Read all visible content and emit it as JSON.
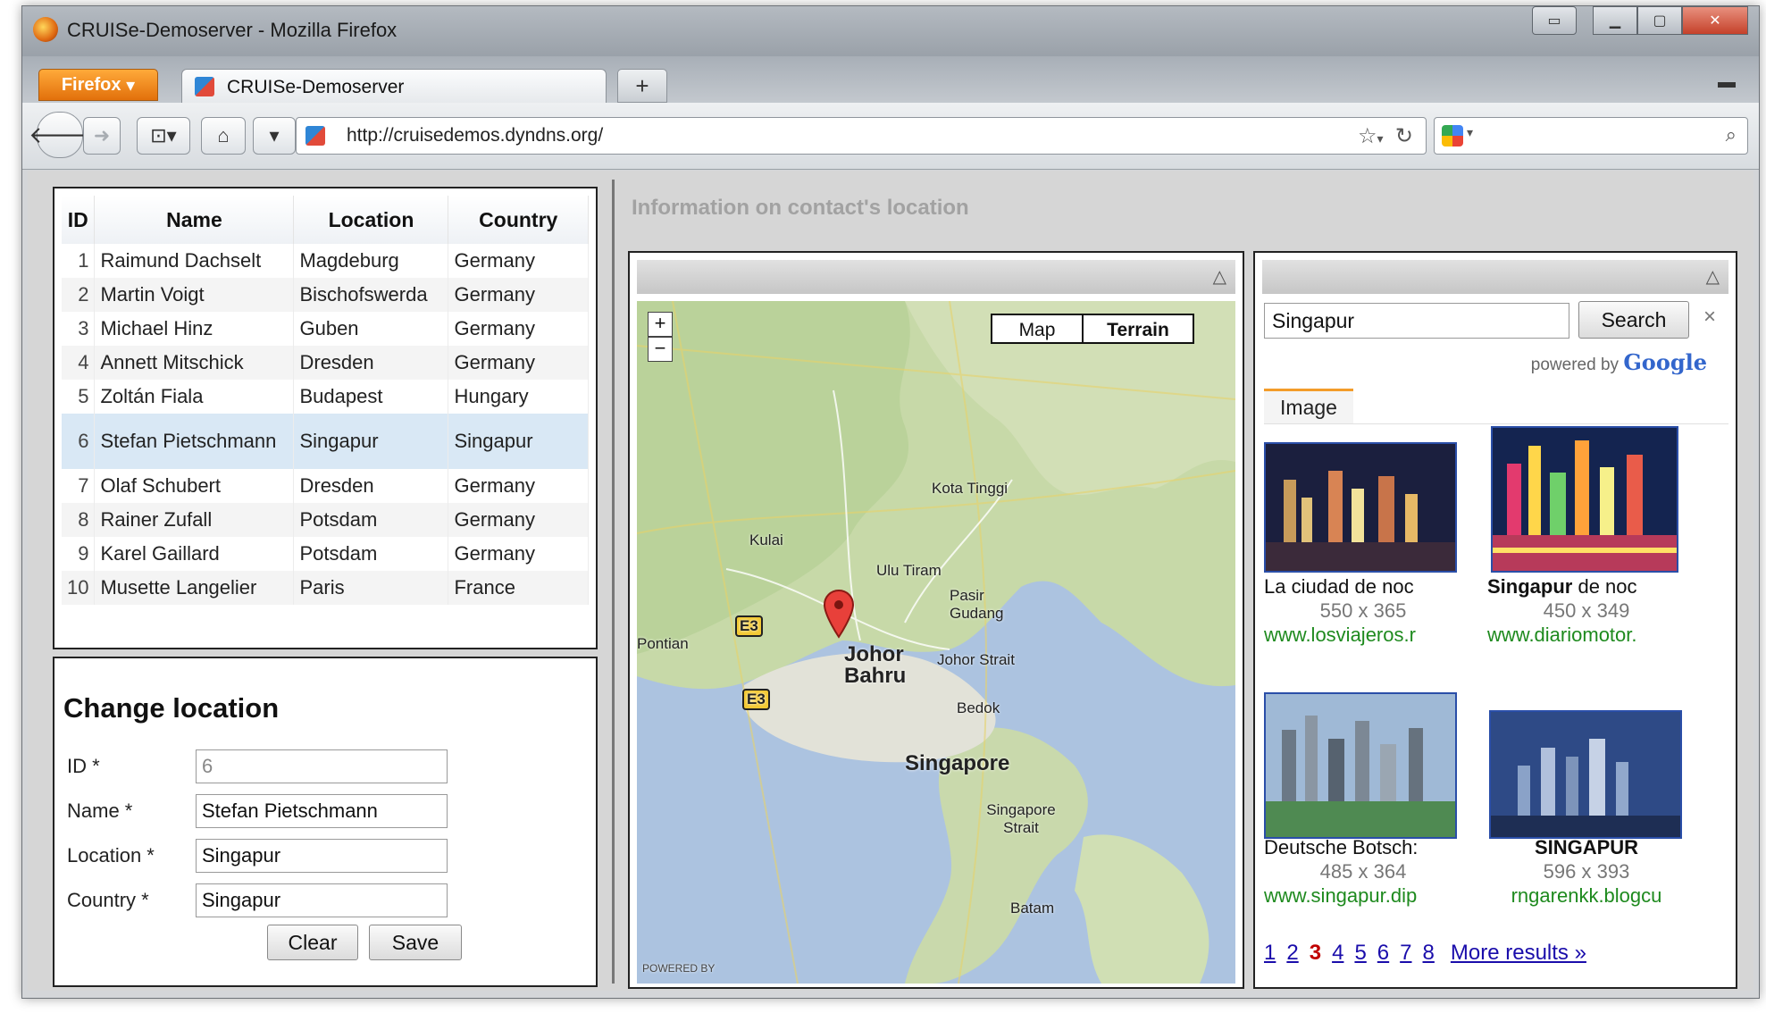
{
  "window": {
    "title": "CRUISe-Demoserver - Mozilla Firefox"
  },
  "browser": {
    "menu_label": "Firefox",
    "tab_title": "CRUISe-Demoserver",
    "new_tab": "+",
    "url": "http://cruisedemos.dyndns.org/"
  },
  "contacts": {
    "columns": [
      "ID",
      "Name",
      "Location",
      "Country"
    ],
    "rows": [
      {
        "id": "1",
        "name": "Raimund Dachselt",
        "location": "Magdeburg",
        "country": "Germany"
      },
      {
        "id": "2",
        "name": "Martin Voigt",
        "location": "Bischofswerda",
        "country": "Germany"
      },
      {
        "id": "3",
        "name": "Michael Hinz",
        "location": "Guben",
        "country": "Germany"
      },
      {
        "id": "4",
        "name": "Annett Mitschick",
        "location": "Dresden",
        "country": "Germany"
      },
      {
        "id": "5",
        "name": "Zoltán Fiala",
        "location": "Budapest",
        "country": "Hungary"
      },
      {
        "id": "6",
        "name": "Stefan Pietschmann",
        "location": "Singapur",
        "country": "Singapur"
      },
      {
        "id": "7",
        "name": "Olaf Schubert",
        "location": "Dresden",
        "country": "Germany"
      },
      {
        "id": "8",
        "name": "Rainer Zufall",
        "location": "Potsdam",
        "country": "Germany"
      },
      {
        "id": "9",
        "name": "Karel Gaillard",
        "location": "Potsdam",
        "country": "Germany"
      },
      {
        "id": "10",
        "name": "Musette Langelier",
        "location": "Paris",
        "country": "France"
      }
    ],
    "selected_id": "6"
  },
  "form": {
    "title": "Change location",
    "id_label": "ID *",
    "id_value": "6",
    "name_label": "Name *",
    "name_value": "Stefan Pietschmann",
    "location_label": "Location *",
    "location_value": "Singapur",
    "country_label": "Country *",
    "country_value": "Singapur",
    "clear_label": "Clear",
    "save_label": "Save"
  },
  "info": {
    "title": "Information on contact's location"
  },
  "map": {
    "type_map": "Map",
    "type_terrain": "Terrain",
    "selected_type": "Terrain",
    "zoom_in": "+",
    "zoom_out": "−",
    "labels": [
      "Kota Tinggi",
      "Kulai",
      "Ulu Tiram",
      "Pasir Gudang",
      "Johor Strait",
      "Johor Bahru",
      "Bedok",
      "Singapore",
      "Singapore Strait",
      "Batam",
      "Pontian",
      "E3"
    ],
    "powered": "POWERED BY"
  },
  "image_search": {
    "query": "Singapur",
    "search_label": "Search",
    "powered_by": "powered by",
    "google": "Google",
    "tab": "Image",
    "results": [
      {
        "title": "La ciudad de noc",
        "size": "550 x 365",
        "url": "www.losviajeros.r",
        "color": "#2a2f5a"
      },
      {
        "title_bold": "Singapur",
        "title_rest": " de noc",
        "size": "450 x 349",
        "url": "www.diariomotor.",
        "color": "#1c2a58"
      },
      {
        "title": "Deutsche Botsch:",
        "size": "485 x 364",
        "url": "www.singapur.dip",
        "color": "#6f8fb0"
      },
      {
        "title_bold": "SINGAPUR",
        "size": "596 x 393",
        "url": "rngarenkk.blogcu",
        "color": "#32508a"
      }
    ],
    "pages": [
      "1",
      "2",
      "3",
      "4",
      "5",
      "6",
      "7",
      "8"
    ],
    "current_page": "3",
    "more": "More results »"
  }
}
